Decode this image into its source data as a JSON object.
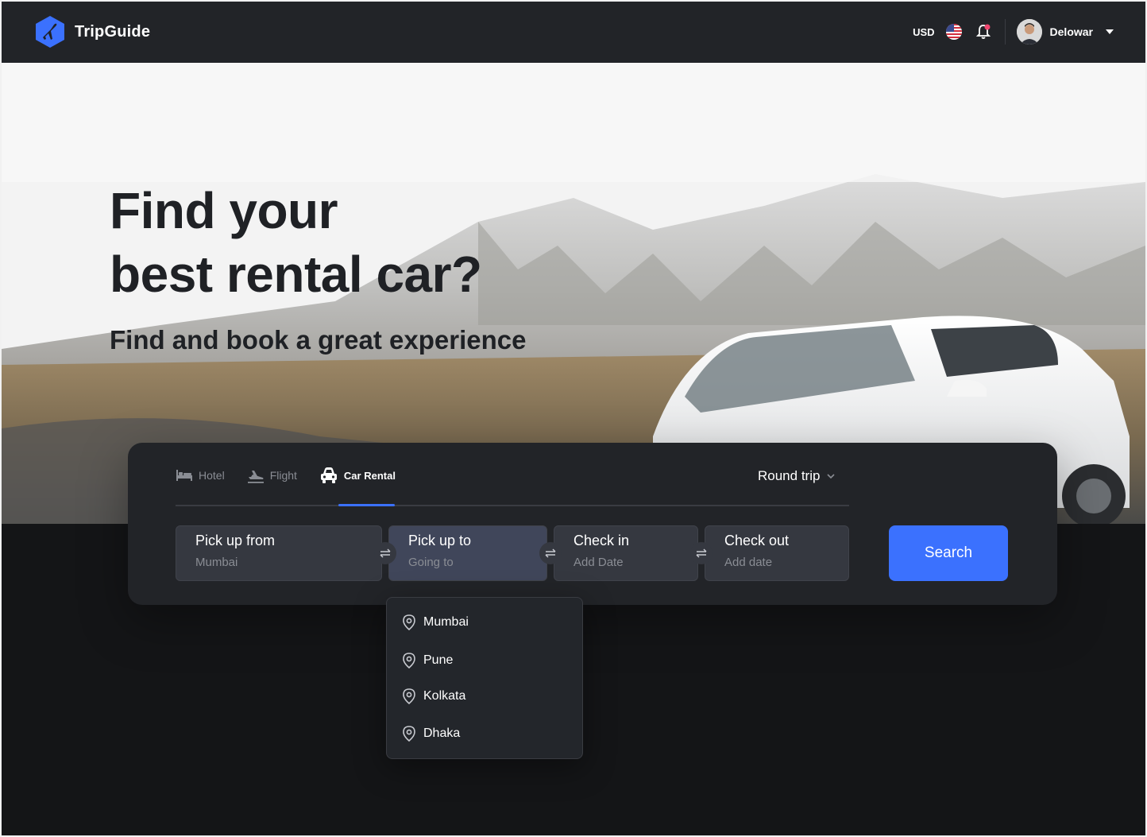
{
  "nav": {
    "brand": "TripGuide",
    "currency": "USD",
    "username": "Delowar"
  },
  "hero": {
    "title_line1": "Find your",
    "title_line2": "best rental car?",
    "subtitle": "Find and book a great experience"
  },
  "search": {
    "tabs": [
      {
        "label": "Hotel",
        "icon": "bed-icon",
        "active": false
      },
      {
        "label": "Flight",
        "icon": "plane-icon",
        "active": false
      },
      {
        "label": "Car Rental",
        "icon": "car-icon",
        "active": true
      }
    ],
    "trip_type": "Round trip",
    "fields": [
      {
        "label": "Pick up from",
        "value": "Mumbai"
      },
      {
        "label": "Pick up to",
        "value": "Going to"
      },
      {
        "label": "Check in",
        "value": "Add Date"
      },
      {
        "label": "Check out",
        "value": "Add date"
      }
    ],
    "search_button": "Search"
  },
  "dropdown": {
    "items": [
      "Mumbai",
      "Pune",
      "Kolkata",
      "Dhaka"
    ]
  },
  "colors": {
    "accent": "#3b71fe",
    "navbar": "#222428",
    "card": "#222428",
    "page_bg": "#141517"
  }
}
